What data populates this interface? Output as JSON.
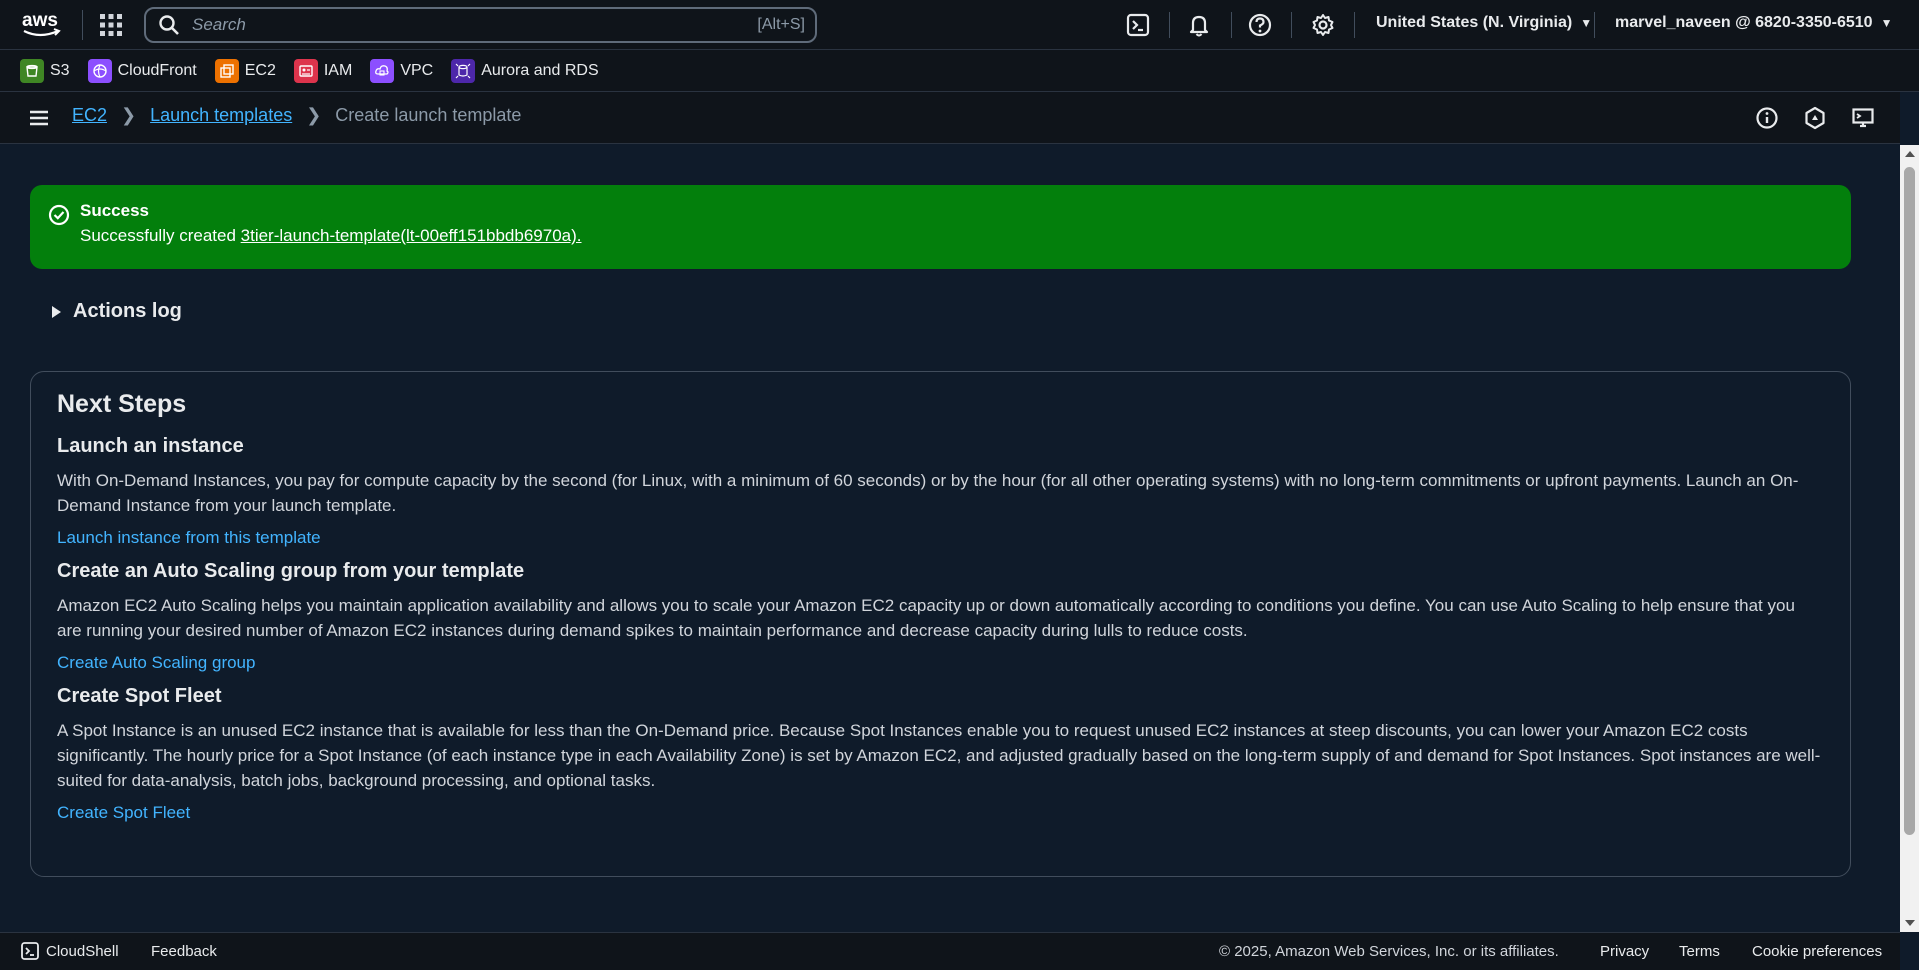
{
  "topnav": {
    "logo_text": "aws",
    "search_placeholder": "Search",
    "search_shortcut": "[Alt+S]",
    "region": "United States (N. Virginia)",
    "account": "marvel_naveen @ 6820-3350-6510"
  },
  "favorites": [
    {
      "label": "S3",
      "color": "#3f8624"
    },
    {
      "label": "CloudFront",
      "color": "#8c4fff"
    },
    {
      "label": "EC2",
      "color": "#ed7100"
    },
    {
      "label": "IAM",
      "color": "#dd344c"
    },
    {
      "label": "VPC",
      "color": "#8c4fff"
    },
    {
      "label": "Aurora and RDS",
      "color": "#4d27aa"
    }
  ],
  "breadcrumb": {
    "items": [
      "EC2",
      "Launch templates"
    ],
    "current": "Create launch template"
  },
  "flash": {
    "title": "Success",
    "message_prefix": "Successfully created ",
    "link": "3tier-launch-template(lt-00eff151bbdb6970a).",
    "color": "#037f0c"
  },
  "actions_log": "Actions log",
  "next_steps": {
    "title": "Next Steps",
    "sections": [
      {
        "heading": "Launch an instance",
        "body": "With On-Demand Instances, you pay for compute capacity by the second (for Linux, with a minimum of 60 seconds) or by the hour (for all other operating systems) with no long-term commitments or upfront payments. Launch an On-Demand Instance from your launch template.",
        "link": "Launch instance from this template"
      },
      {
        "heading": "Create an Auto Scaling group from your template",
        "body": "Amazon EC2 Auto Scaling helps you maintain application availability and allows you to scale your Amazon EC2 capacity up or down automatically according to conditions you define. You can use Auto Scaling to help ensure that you are running your desired number of Amazon EC2 instances during demand spikes to maintain performance and decrease capacity during lulls to reduce costs.",
        "link": "Create Auto Scaling group"
      },
      {
        "heading": "Create Spot Fleet",
        "body": "A Spot Instance is an unused EC2 instance that is available for less than the On-Demand price. Because Spot Instances enable you to request unused EC2 instances at steep discounts, you can lower your Amazon EC2 costs significantly. The hourly price for a Spot Instance (of each instance type in each Availability Zone) is set by Amazon EC2, and adjusted gradually based on the long-term supply of and demand for Spot Instances. Spot instances are well-suited for data-analysis, batch jobs, background processing, and optional tasks.",
        "link": "Create Spot Fleet"
      }
    ]
  },
  "footer": {
    "cloudshell": "CloudShell",
    "feedback": "Feedback",
    "copyright": "© 2025, Amazon Web Services, Inc. or its affiliates.",
    "privacy": "Privacy",
    "terms": "Terms",
    "cookies": "Cookie preferences"
  },
  "colors": {
    "link": "#42b4ff",
    "background": "#0f1b2a",
    "nav_background": "#0f141a"
  }
}
